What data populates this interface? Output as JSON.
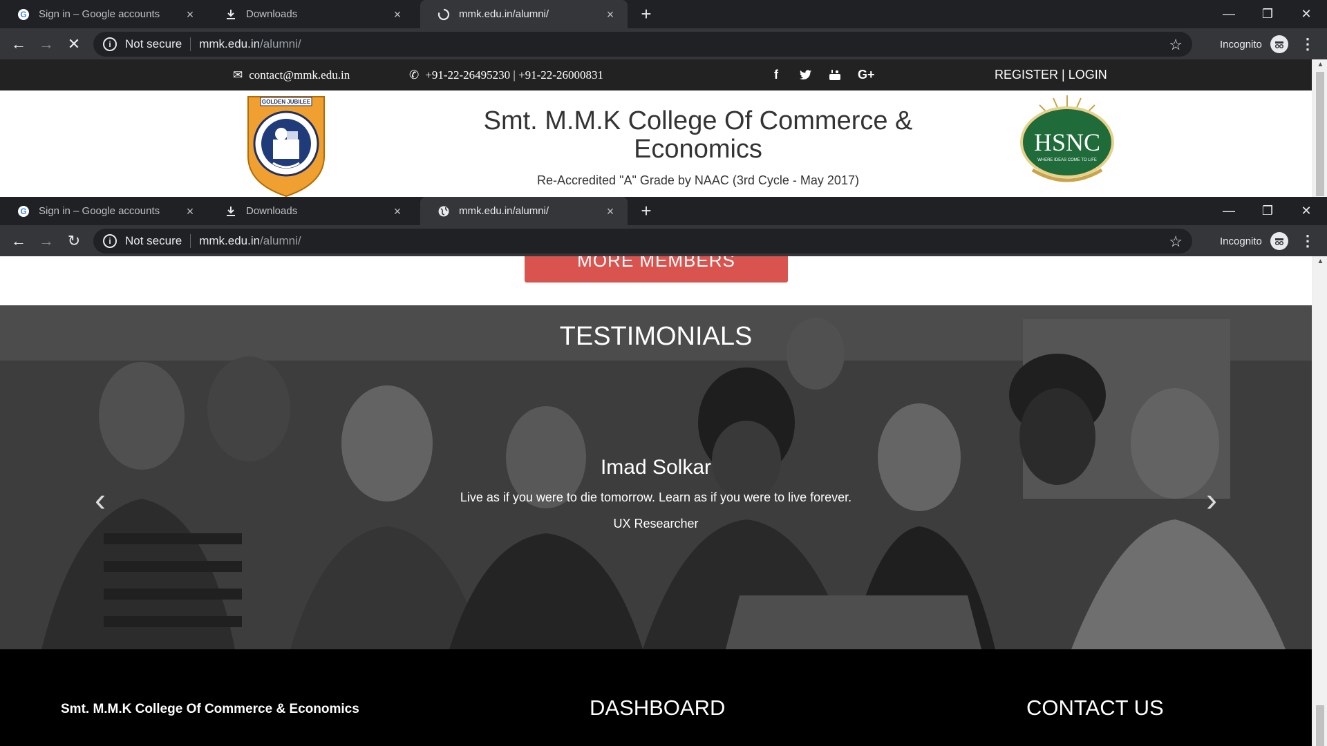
{
  "browser": {
    "tabs": [
      {
        "title": "Sign in – Google accounts",
        "icon": "google-icon"
      },
      {
        "title": "Downloads",
        "icon": "download-icon"
      },
      {
        "title": "mmk.edu.in/alumni/",
        "icon": "globe-icon"
      }
    ],
    "omnibox": {
      "security_text": "Not secure",
      "host": "mmk.edu.in",
      "path": "/alumni/"
    },
    "profile_label": "Incognito"
  },
  "site": {
    "topbar": {
      "email": "contact@mmk.edu.in",
      "phone": "+91-22-26495230 | +91-22-26000831",
      "social": [
        "facebook-icon",
        "twitter-icon",
        "youtube-icon",
        "google-plus-icon"
      ],
      "register_login": "REGISTER | LOGIN"
    },
    "header": {
      "college_name": "Smt. M.M.K College Of Commerce & Economics",
      "accreditation": "Re-Accredited \"A\" Grade by NAAC (3rd Cycle - May 2017)",
      "left_logo_text": "GOLDEN JUBILEE",
      "right_logo_text": "HSNC",
      "right_logo_tagline": "WHERE IDEAS COME TO LIFE"
    },
    "more_members_button": "MORE MEMBERS",
    "testimonials": {
      "heading": "TESTIMONIALS",
      "name": "Imad Solkar",
      "quote": "Live as if you were to die tomorrow. Learn as if you were to live forever.",
      "role": "UX Researcher"
    },
    "footer": {
      "college_name": "Smt. M.M.K College Of Commerce & Economics",
      "dashboard_heading": "DASHBOARD",
      "contact_heading": "CONTACT US"
    }
  },
  "colors": {
    "chrome_dark": "#202124",
    "chrome_toolbar": "#35363a",
    "button_red": "#d9534f",
    "hsnc_green": "#1f6b3a"
  }
}
